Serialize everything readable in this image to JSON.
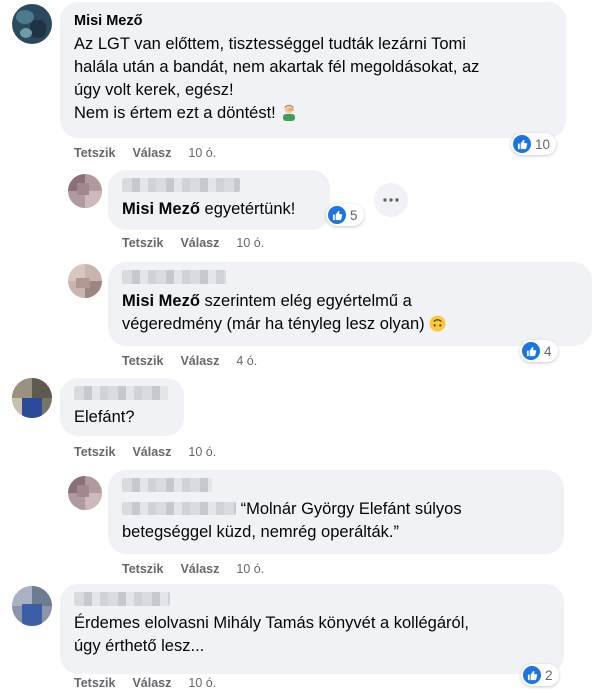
{
  "colors": {
    "bubble": "#f0f2f5",
    "like_blue": "#1b74e4",
    "meta_gray": "#65676b",
    "text": "#050505"
  },
  "labels": {
    "like": "Tetszik",
    "reply": "Válasz"
  },
  "comments": [
    {
      "author": "Misi Mező",
      "text_lines": [
        "Az LGT van előttem, tisztességgel tudták lezárni Tomi",
        "halála után a bandát, nem akartak fél megoldásokat, az",
        "úgy volt kerek, egész!",
        "Nem is értem ezt a döntést!"
      ],
      "emoji": "man-facepalming-icon",
      "time": "10 ó.",
      "reactions": "10",
      "replies": [
        {
          "author_blurred": true,
          "mention": "Misi Mező",
          "text": " egyetértünk!",
          "time": "10 ó.",
          "reactions": "5"
        },
        {
          "author_blurred": true,
          "mention": "Misi Mező",
          "text_line1": " szerintem elég egyértelmű a",
          "text_line2": "végeredmény (már ha tényleg lesz olyan)",
          "emoji": "upside-down-face-icon",
          "time": "4 ó.",
          "reactions": "4"
        }
      ]
    },
    {
      "author_blurred": true,
      "text": "Elefánt?",
      "time": "10 ó.",
      "replies": [
        {
          "author_blurred": true,
          "text_line1": " “Molnár György Elefánt súlyos",
          "text_line2": "betegséggel küzd, nemrég operálták.”",
          "time": "10 ó."
        }
      ]
    },
    {
      "author_blurred": true,
      "text_lines": [
        "Érdemes elolvasni Mihály Tamás könyvét a kollégáról,",
        "úgy érthető lesz..."
      ],
      "time": "10 ó.",
      "reactions": "2"
    }
  ]
}
